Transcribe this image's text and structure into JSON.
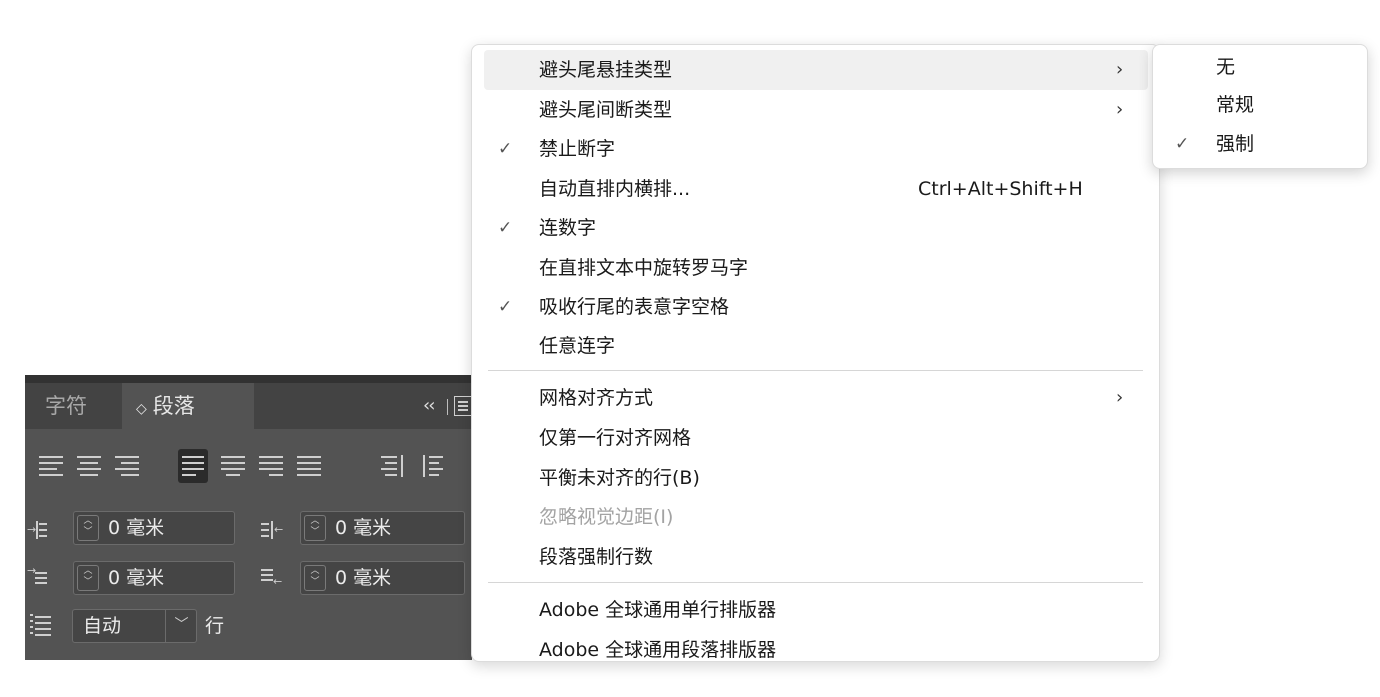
{
  "panel": {
    "tabs": [
      {
        "label": "字符",
        "active": false
      },
      {
        "label": "段落",
        "active": true,
        "icon": "diamond-icon"
      }
    ],
    "collapse_glyph": "‹‹",
    "alignment_buttons": [
      "align-left",
      "align-center",
      "align-right",
      "justify-last-left",
      "justify-last-center",
      "justify-last-right",
      "justify-all",
      "align-toward-spine",
      "align-away-from-spine"
    ],
    "selected_alignment": "justify-last-left",
    "left_indent": "0 毫米",
    "right_indent": "0 毫米",
    "first_line_indent": "0 毫米",
    "last_line_right_indent": "0 毫米",
    "grid_lines_value": "自动",
    "grid_lines_unit": "行"
  },
  "menu": {
    "items": [
      {
        "label": "避头尾悬挂类型",
        "checked": false,
        "submenu": true,
        "highlighted": true
      },
      {
        "label": "避头尾间断类型",
        "checked": false,
        "submenu": true
      },
      {
        "label": "禁止断字",
        "checked": true
      },
      {
        "label": "自动直排内横排...",
        "checked": false,
        "shortcut": "Ctrl+Alt+Shift+H"
      },
      {
        "label": "连数字",
        "checked": true
      },
      {
        "label": "在直排文本中旋转罗马字",
        "checked": false
      },
      {
        "label": "吸收行尾的表意字空格",
        "checked": true
      },
      {
        "label": "任意连字",
        "checked": false
      },
      {
        "label": "网格对齐方式",
        "checked": false,
        "submenu": true
      },
      {
        "label": "仅第一行对齐网格",
        "checked": false
      },
      {
        "label": "平衡未对齐的行(B)",
        "checked": false
      },
      {
        "label": "忽略视觉边距(I)",
        "checked": false,
        "disabled": true
      },
      {
        "label": "段落强制行数",
        "checked": false
      },
      {
        "label": "Adobe 全球通用单行排版器",
        "checked": false
      },
      {
        "label": "Adobe 全球通用段落排版器",
        "checked": false
      }
    ],
    "check_glyph": "✓",
    "arrow_glyph": "›"
  },
  "submenu": {
    "items": [
      {
        "label": "无",
        "checked": false
      },
      {
        "label": "常规",
        "checked": false
      },
      {
        "label": "强制",
        "checked": true
      }
    ]
  }
}
